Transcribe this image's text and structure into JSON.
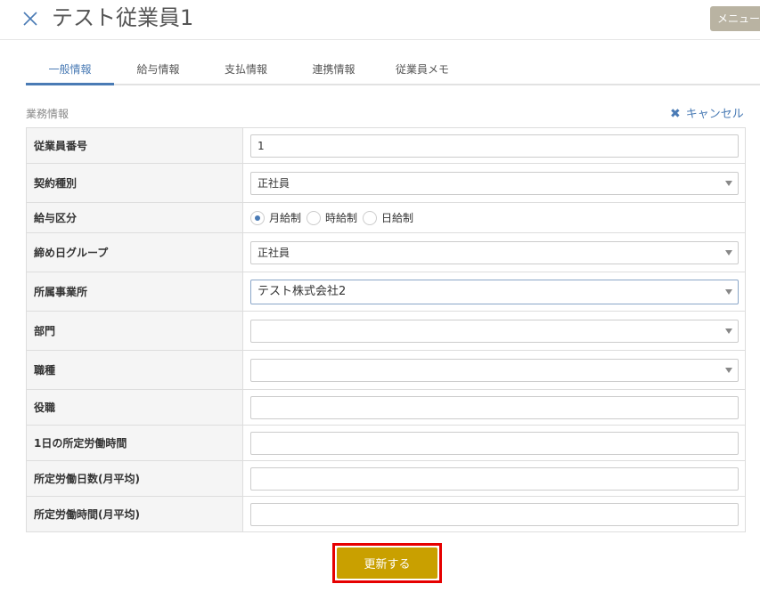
{
  "header": {
    "title": "テスト従業員1",
    "menu_label": "メニュー"
  },
  "tabs": [
    {
      "label": "一般情報",
      "active": true
    },
    {
      "label": "給与情報",
      "active": false
    },
    {
      "label": "支払情報",
      "active": false
    },
    {
      "label": "連携情報",
      "active": false
    },
    {
      "label": "従業員メモ",
      "active": false
    }
  ],
  "section": {
    "label": "業務情報",
    "cancel_label": "キャンセル"
  },
  "form": {
    "employee_number": {
      "label": "従業員番号",
      "value": "1"
    },
    "contract_type": {
      "label": "契約種別",
      "value": "正社員"
    },
    "pay_type": {
      "label": "給与区分",
      "options": [
        "月給制",
        "時給制",
        "日給制"
      ],
      "selected": "月給制"
    },
    "closing_group": {
      "label": "締め日グループ",
      "value": "正社員"
    },
    "office": {
      "label": "所属事業所",
      "value": "テスト株式会社2"
    },
    "department": {
      "label": "部門",
      "value": ""
    },
    "job_type": {
      "label": "職種",
      "value": ""
    },
    "position": {
      "label": "役職",
      "value": ""
    },
    "daily_hours": {
      "label": "1日の所定労働時間",
      "value": ""
    },
    "monthly_days": {
      "label": "所定労働日数(月平均)",
      "value": ""
    },
    "monthly_hours": {
      "label": "所定労働時間(月平均)",
      "value": ""
    }
  },
  "submit_label": "更新する",
  "colors": {
    "accent": "#4a7bb5",
    "submit": "#c9a000",
    "highlight_border": "#e60000",
    "menu_button": "#b9b3a2"
  }
}
